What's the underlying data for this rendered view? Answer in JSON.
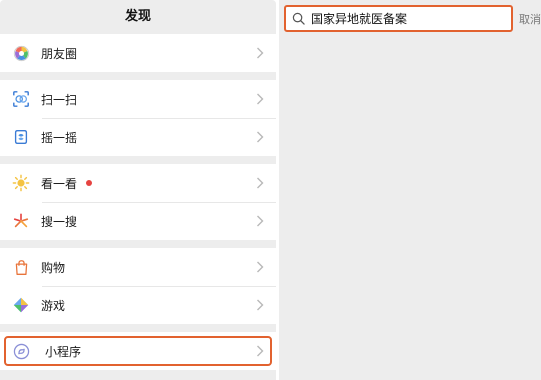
{
  "discover": {
    "title": "发现",
    "groups": [
      {
        "items": [
          {
            "label": "朋友圈",
            "icon": "moments-icon"
          }
        ]
      },
      {
        "items": [
          {
            "label": "扫一扫",
            "icon": "scan-icon"
          },
          {
            "label": "摇一摇",
            "icon": "shake-icon"
          }
        ]
      },
      {
        "items": [
          {
            "label": "看一看",
            "icon": "top-stories-icon",
            "badge": "red-dot"
          },
          {
            "label": "搜一搜",
            "icon": "search-discover-icon"
          }
        ]
      },
      {
        "items": [
          {
            "label": "购物",
            "icon": "shopping-bag-icon"
          },
          {
            "label": "游戏",
            "icon": "games-icon"
          }
        ]
      },
      {
        "items": [
          {
            "label": "小程序",
            "icon": "mini-program-icon",
            "highlighted": true
          }
        ]
      }
    ]
  },
  "search": {
    "query": "国家异地就医备案",
    "cancel_label": "取消"
  },
  "colors": {
    "highlight": "#e2622f",
    "badge": "#e64340",
    "background": "#ededed"
  }
}
